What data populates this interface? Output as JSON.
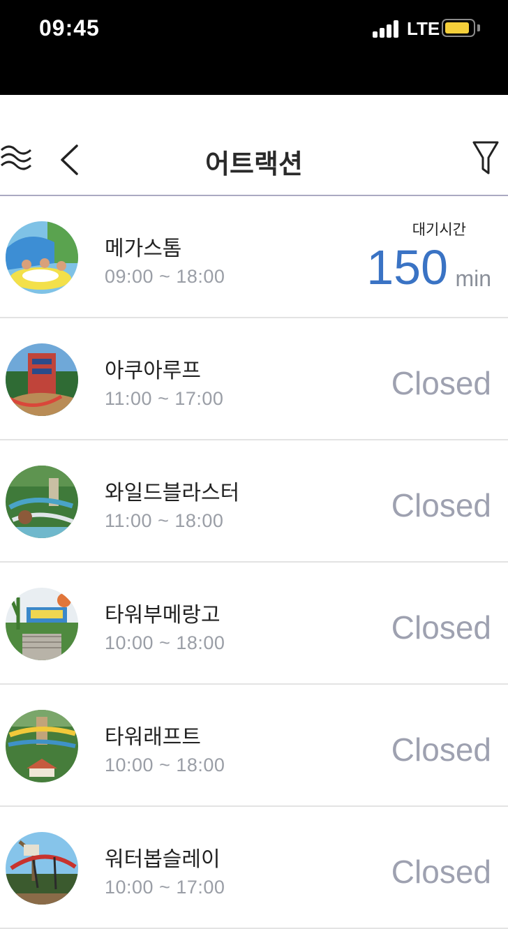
{
  "status_bar": {
    "time": "09:45",
    "network": "LTE"
  },
  "header": {
    "title": "어트랙션"
  },
  "wait_label": "대기시간",
  "attractions": [
    {
      "name": "메가스톰",
      "hours": "09:00 ~ 18:00",
      "wait": "150",
      "unit": "min"
    },
    {
      "name": "아쿠아루프",
      "hours": "11:00 ~ 17:00",
      "status": "Closed"
    },
    {
      "name": "와일드블라스터",
      "hours": "11:00 ~ 18:00",
      "status": "Closed"
    },
    {
      "name": "타워부메랑고",
      "hours": "10:00 ~ 18:00",
      "status": "Closed"
    },
    {
      "name": "타워래프트",
      "hours": "10:00 ~ 18:00",
      "status": "Closed"
    },
    {
      "name": "워터봅슬레이",
      "hours": "10:00 ~ 17:00",
      "status": "Closed"
    }
  ],
  "colors": {
    "accent": "#3a73c4",
    "closed": "#9ea1b0",
    "battery": "#f5cf3a"
  }
}
